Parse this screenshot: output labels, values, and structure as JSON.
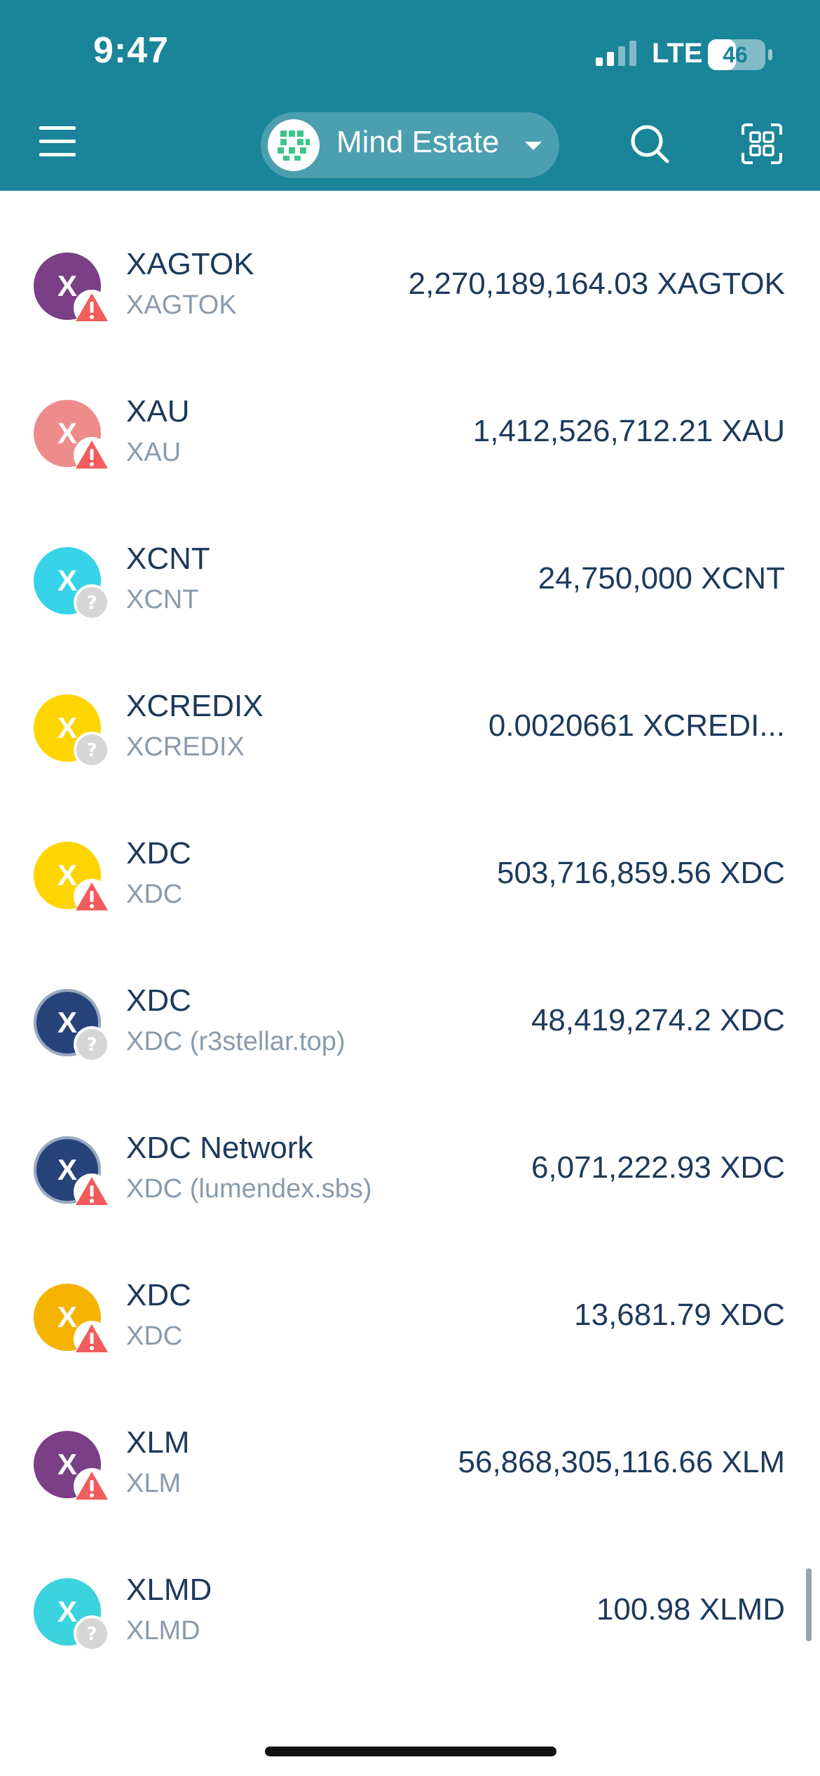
{
  "status_bar": {
    "time": "9:47",
    "network": "LTE",
    "battery": "46"
  },
  "header": {
    "wallet_name": "Mind Estate"
  },
  "assets": [
    {
      "name": "XAGTOK",
      "issuer": "XAGTOK",
      "balance": "2,270,189,164.03 XAGTOK",
      "letter": "X",
      "color": "#7b3f86",
      "badge": "warning"
    },
    {
      "name": "XAU",
      "issuer": "XAU",
      "balance": "1,412,526,712.21 XAU",
      "letter": "X",
      "color": "#ee8c8c",
      "badge": "warning"
    },
    {
      "name": "XCNT",
      "issuer": "XCNT",
      "balance": "24,750,000 XCNT",
      "letter": "X",
      "color": "#37d3e8",
      "badge": "unknown"
    },
    {
      "name": "XCREDIX",
      "issuer": "XCREDIX",
      "balance": "0.0020661 XCREDI...",
      "letter": "X",
      "color": "#ffd500",
      "badge": "unknown"
    },
    {
      "name": "XDC",
      "issuer": "XDC",
      "balance": "503,716,859.56 XDC",
      "letter": "X",
      "color": "#ffd500",
      "badge": "warning"
    },
    {
      "name": "XDC",
      "issuer": "XDC (r3stellar.top)",
      "balance": "48,419,274.2 XDC",
      "letter": "X",
      "color": "#26437a",
      "badge": "unknown"
    },
    {
      "name": "XDC Network",
      "issuer": "XDC (lumendex.sbs)",
      "balance": "6,071,222.93 XDC",
      "letter": "X",
      "color": "#26437a",
      "badge": "warning"
    },
    {
      "name": "XDC",
      "issuer": "XDC",
      "balance": "13,681.79 XDC",
      "letter": "X",
      "color": "#f5b300",
      "badge": "warning"
    },
    {
      "name": "XLM",
      "issuer": "XLM",
      "balance": "56,868,305,116.66 XLM",
      "letter": "X",
      "color": "#7b3f86",
      "badge": "warning"
    },
    {
      "name": "XLMD",
      "issuer": "XLMD",
      "balance": "100.98 XLMD",
      "letter": "X",
      "color": "#3bd3dd",
      "badge": "unknown"
    }
  ],
  "colors": {
    "header_bg": "#1a8499",
    "text_primary": "#1d3a5c",
    "text_secondary": "#8a9bad",
    "warning": "#f25c5c",
    "unknown": "#d6d6d6"
  }
}
